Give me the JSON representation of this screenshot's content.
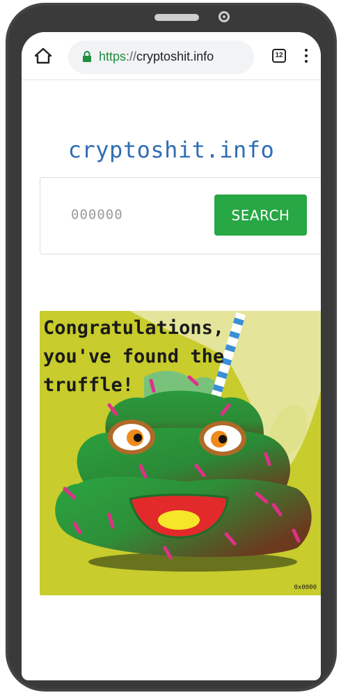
{
  "browser": {
    "url_scheme": "https",
    "url_separator": "://",
    "url_host": "cryptoshit.info",
    "tab_count": "12"
  },
  "page": {
    "title": "cryptoshit.info",
    "search": {
      "placeholder": "000000",
      "button_label": "SEARCH"
    },
    "artwork": {
      "caption": "Congratulations,\nyou've found the\ntruffle!",
      "code": "0x0000",
      "colors": {
        "background": "#c8cc2c",
        "pale_shape": "#e4e59a",
        "body_green": "#2a9a3e",
        "body_brown": "#6b3a1e",
        "mouth_red": "#e32a2a",
        "mouth_yellow": "#f5e62a",
        "sprinkles": "#e0308a",
        "eye_iris": "#f08a1a"
      }
    }
  }
}
